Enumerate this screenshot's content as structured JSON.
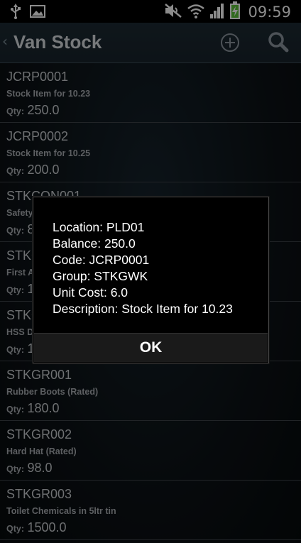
{
  "status_bar": {
    "time": "09:59",
    "icons": [
      "usb-icon",
      "image-icon",
      "no-sound-icon",
      "wifi-icon",
      "signal-icon",
      "battery-charging-icon"
    ]
  },
  "action_bar": {
    "title": "Van Stock",
    "icons": [
      "back-chevron-icon",
      "add-circle-icon",
      "search-icon"
    ]
  },
  "list": {
    "qty_label": "Qty:",
    "items": [
      {
        "code": "JCRP0001",
        "description": "Stock Item for 10.23",
        "qty": "250.0"
      },
      {
        "code": "JCRP0002",
        "description": "Stock Item for 10.25",
        "qty": "200.0"
      },
      {
        "code": "STKCON001",
        "description": "Safety",
        "qty": "8"
      },
      {
        "code": "STKG",
        "description": "First A",
        "qty": "1"
      },
      {
        "code": "STKG",
        "description": "HSS D",
        "qty": "1"
      },
      {
        "code": "STKGR001",
        "description": "Rubber Boots (Rated)",
        "qty": "180.0"
      },
      {
        "code": "STKGR002",
        "description": "Hard Hat (Rated)",
        "qty": "98.0"
      },
      {
        "code": "STKGR003",
        "description": "Toilet Chemicals in 5ltr tin",
        "qty": "1500.0"
      }
    ]
  },
  "dialog": {
    "lines": [
      "Location: PLD01",
      "Balance: 250.0",
      "Code: JCRP0001",
      "Group: STKGWK",
      "Unit Cost: 6.0",
      "Description: Stock Item for 10.23"
    ],
    "ok_label": "OK"
  }
}
